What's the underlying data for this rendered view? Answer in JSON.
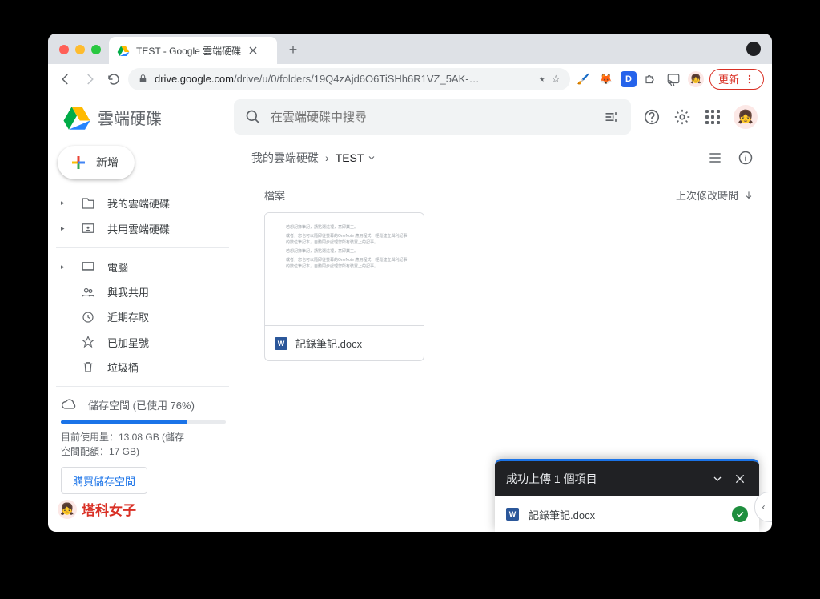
{
  "browser": {
    "tab_title": "TEST - Google 雲端硬碟",
    "url_host": "drive.google.com",
    "url_path": "/drive/u/0/folders/19Q4zAjd6O6TiSHh6R1VZ_5AK-…",
    "update_label": "更新"
  },
  "header": {
    "product": "雲端硬碟",
    "search_placeholder": "在雲端硬碟中搜尋"
  },
  "sidebar": {
    "new_label": "新增",
    "items": [
      {
        "label": "我的雲端硬碟",
        "expandable": true,
        "icon": "drive"
      },
      {
        "label": "共用雲端硬碟",
        "expandable": true,
        "icon": "shared-drive"
      }
    ],
    "items2": [
      {
        "label": "電腦",
        "icon": "computer"
      },
      {
        "label": "與我共用",
        "icon": "people"
      },
      {
        "label": "近期存取",
        "icon": "clock"
      },
      {
        "label": "已加星號",
        "icon": "star"
      },
      {
        "label": "垃圾桶",
        "icon": "trash"
      }
    ],
    "storage": {
      "head": "儲存空間 (已使用 76%)",
      "percent": 76,
      "line1": "目前使用量：13.08 GB (儲存",
      "line2": "空間配額：17 GB)",
      "buy_label": "購買儲存空間"
    },
    "watermark": "塔科女子"
  },
  "main": {
    "breadcrumb_root": "我的雲端硬碟",
    "breadcrumb_current": "TEST",
    "section_label": "檔案",
    "col_modified": "上次修改時間",
    "file_name": "記錄筆記.docx",
    "thumb_lines": [
      "若想記錄筆記，請點選這裡，意即業主。",
      "或者，您也可以隨即從螢幕的OneNote 應用程式，輕鬆建立與利記事的數位筆記本，自動同步處理您所有裝置上的記事。",
      "若想記錄筆記，請點選這裡，意即業主。",
      "或者，您也可以隨即從螢幕的OneNote 應用程式，輕鬆建立與利記事的數位筆記本，自動同步處理您所有裝置上的記事。"
    ]
  },
  "toast": {
    "title": "成功上傳 1 個項目",
    "item": "記錄筆記.docx"
  }
}
